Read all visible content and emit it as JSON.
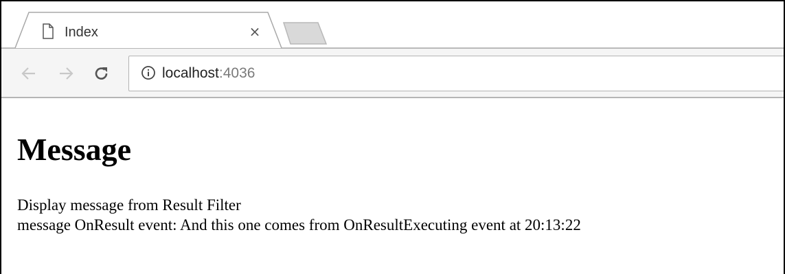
{
  "browser": {
    "tab": {
      "title": "Index",
      "close_glyph": "×",
      "icon": "page-icon"
    },
    "new_tab_icon": "new-tab-icon",
    "nav": {
      "back_icon": "arrow-left-icon",
      "forward_icon": "arrow-right-icon",
      "reload_icon": "reload-icon"
    },
    "address_bar": {
      "info_icon": "info-icon",
      "host": "localhost",
      "port": ":4036"
    }
  },
  "page": {
    "heading": "Message",
    "lines": [
      "Display message from Result Filter",
      "message OnResult event: And this one comes from OnResultExecuting event at 20:13:22"
    ]
  }
}
